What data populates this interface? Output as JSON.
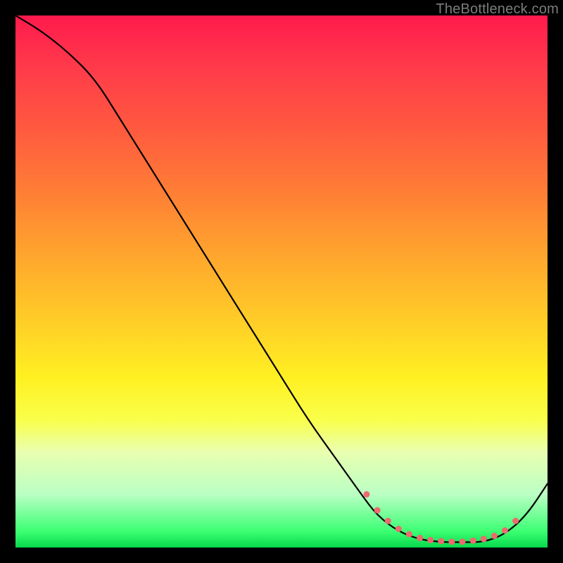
{
  "watermark": "TheBottleneck.com",
  "chart_data": {
    "type": "line",
    "title": "",
    "xlabel": "",
    "ylabel": "",
    "xlim": [
      0,
      100
    ],
    "ylim": [
      0,
      100
    ],
    "grid": false,
    "legend": false,
    "background_gradient": {
      "direction": "vertical",
      "stops": [
        {
          "pos": 0,
          "color": "#ff1a4d"
        },
        {
          "pos": 10,
          "color": "#ff3b4a"
        },
        {
          "pos": 20,
          "color": "#ff5640"
        },
        {
          "pos": 32,
          "color": "#ff7a36"
        },
        {
          "pos": 44,
          "color": "#ffa22e"
        },
        {
          "pos": 58,
          "color": "#ffcf27"
        },
        {
          "pos": 68,
          "color": "#fff022"
        },
        {
          "pos": 76,
          "color": "#f9ff4a"
        },
        {
          "pos": 82,
          "color": "#e9ffb0"
        },
        {
          "pos": 90,
          "color": "#baffc4"
        },
        {
          "pos": 97,
          "color": "#3bff73"
        },
        {
          "pos": 100,
          "color": "#07d84c"
        }
      ]
    },
    "series": [
      {
        "name": "bottleneck-curve",
        "color": "#000000",
        "x": [
          0,
          5,
          10,
          15,
          20,
          25,
          30,
          35,
          40,
          45,
          50,
          55,
          60,
          65,
          68,
          72,
          76,
          80,
          84,
          88,
          92,
          96,
          100
        ],
        "y": [
          100,
          97,
          93,
          88,
          80,
          72,
          64,
          56,
          48,
          40,
          32,
          24,
          17,
          10,
          6,
          3,
          1.5,
          1,
          1,
          1,
          2.5,
          6,
          12
        ]
      }
    ],
    "markers": {
      "name": "valley-dots",
      "color": "#ed6a6f",
      "radius_units": 4.5,
      "x": [
        66,
        68,
        70,
        72,
        74,
        76,
        78,
        80,
        82,
        84,
        86,
        88,
        90,
        92,
        94
      ],
      "y": [
        10,
        7,
        5,
        3.5,
        2.5,
        1.8,
        1.4,
        1.2,
        1.1,
        1.1,
        1.3,
        1.6,
        2.2,
        3.2,
        5
      ]
    }
  }
}
